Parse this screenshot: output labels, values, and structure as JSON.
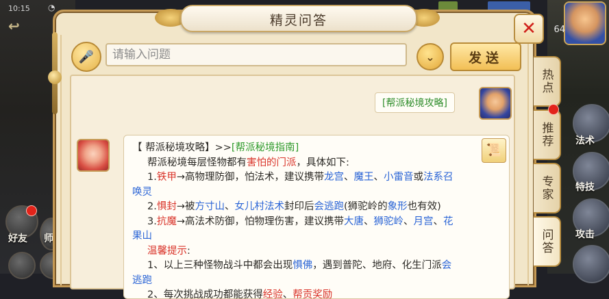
{
  "status": {
    "time": "10:15"
  },
  "hud": {
    "level": "64"
  },
  "left_sidebar": {
    "friends_label": "好友",
    "other_label": "师"
  },
  "right_skills": [
    {
      "label": "法术"
    },
    {
      "label": "特技"
    },
    {
      "label": "攻击"
    }
  ],
  "dialog": {
    "title": "精灵问答",
    "input": {
      "placeholder": "请输入问题",
      "value": ""
    },
    "send_label": "发送",
    "tabs": [
      "热点",
      "推荐",
      "专家",
      "问答"
    ],
    "user_message": "[帮派秘境攻略]",
    "answer": {
      "header_prefix": "【 帮派秘境攻略】>>",
      "header_link": "[帮派秘境指南]",
      "intro_before": "帮派秘境每层怪物都有",
      "intro_highlight": "害怕的门派",
      "intro_after": "，具体如下:",
      "item1_num": "1.",
      "item1_kw": "铁甲",
      "item1_mid": "→高物理防御，怕法术，建议携带",
      "item1_a": "龙宫",
      "item1_sep1": "、",
      "item1_b": "魔王",
      "item1_sep2": "、",
      "item1_c": "小雷音",
      "item1_or": "或",
      "item1_d1": "法系召",
      "item1_d2": "唤灵",
      "item2_num": "2.",
      "item2_kw": "惧封",
      "item2_mid": "→被",
      "item2_a": "方寸山",
      "item2_sep": "、",
      "item2_b": "女儿村法术",
      "item2_mid2": "封印后",
      "item2_c": "会逃跑",
      "item2_paren1": "(狮驼岭的",
      "item2_d": "象形",
      "item2_paren2": "也有效)",
      "item3_num": "3.",
      "item3_kw": "抗魔",
      "item3_mid": "→高法术防御，怕物理伤害，建议携带",
      "item3_a": "大唐",
      "item3_sep1": "、",
      "item3_b": "狮驼岭",
      "item3_sep2": "、",
      "item3_c": "月宫",
      "item3_sep3": "、",
      "item3_d1": "花",
      "item3_d2": "果山",
      "tips_label": "温馨提示",
      "tips_colon": ":",
      "tip1_before": "1、以上三种怪物战斗中都会出现",
      "tip1_kw": "惧佛",
      "tip1_mid": "，遇到普陀、地府、化生门派",
      "tip1_end1": "会",
      "tip1_end2": "逃跑",
      "tip2_before": "2、每次挑战成功都能获得",
      "tip2_a": "经验",
      "tip2_sep": "、",
      "tip2_b": "帮贡奖励"
    }
  },
  "colors": {
    "panel_bg": "#f2e6c9",
    "border_gold": "#c59a56",
    "link_green": "#2f9a2b",
    "highlight_red": "#d9342a",
    "keyword_blue": "#2a64d6",
    "close_red": "#d0211a"
  },
  "icons": {
    "mic": "microphone-icon",
    "dropdown": "chevron-down-icon",
    "close": "close-icon",
    "book": "book-icon"
  }
}
